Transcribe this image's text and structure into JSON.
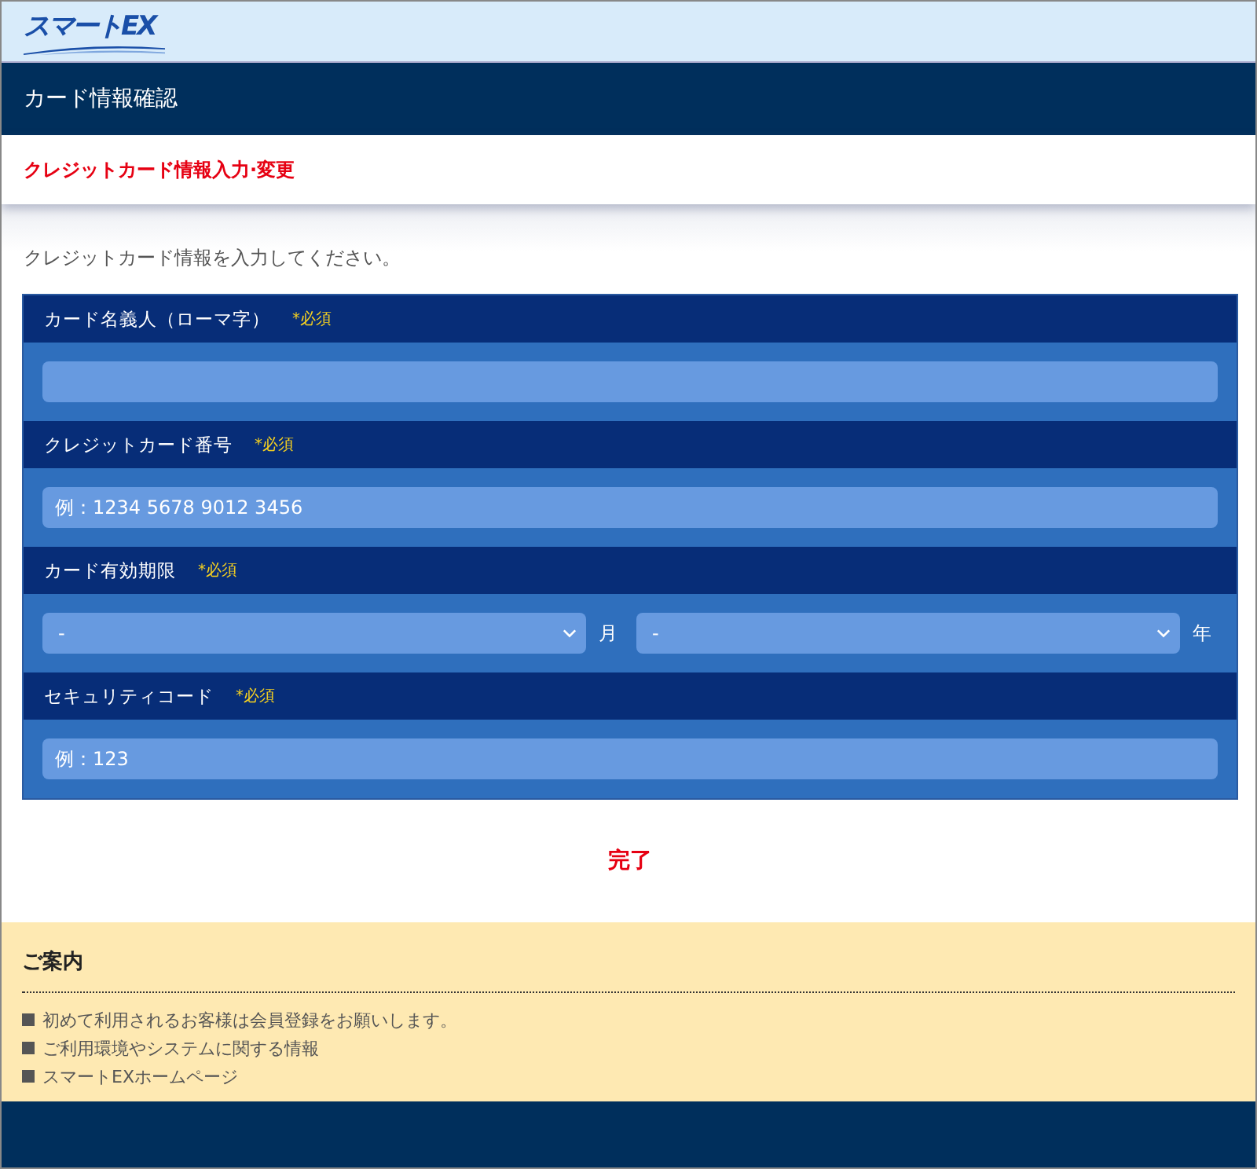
{
  "logo": {
    "text": "スマートEX"
  },
  "header": {
    "title": "カード情報確認"
  },
  "page_title": "クレジットカード情報入力·変更",
  "intro": "クレジットカード情報を入力してください。",
  "fields": [
    {
      "kind": "text",
      "label": "カード名義人（ローマ字）",
      "required": "*必須"
    },
    {
      "kind": "text",
      "label": "クレジットカード番号",
      "required": "*必須",
      "placeholder": "例：1234 5678 9012 3456"
    },
    {
      "kind": "expiry",
      "label": "カード有効期限",
      "required": "*必須",
      "selects": [
        {
          "value": "-",
          "unit": "月"
        },
        {
          "value": "-",
          "unit": "年"
        }
      ]
    },
    {
      "kind": "text",
      "label": "セキュリティコード",
      "required": "*必須",
      "placeholder": "例：123"
    }
  ],
  "submit": "完了",
  "guide": {
    "title": "ご案内",
    "links": [
      "初めて利用されるお客様は会員登録をお願いします。",
      "ご利用環境やシステムに関する情報",
      "スマートEXホームページ"
    ]
  }
}
